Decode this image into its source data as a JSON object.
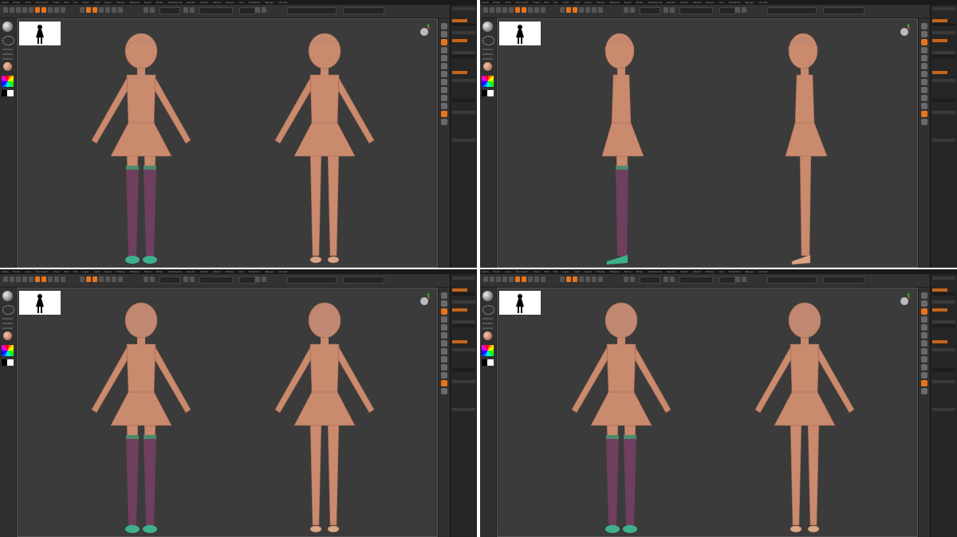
{
  "app": {
    "menu_items": [
      "Alpha",
      "Brush",
      "Color",
      "Document",
      "Draw",
      "Edit",
      "File",
      "Layer",
      "Light",
      "Macro",
      "Marker",
      "Material",
      "Movie",
      "Picker",
      "Preferences",
      "Render",
      "Stencil",
      "Stroke",
      "Texture",
      "Tool",
      "Transform",
      "Zplugin",
      "Zscript"
    ],
    "accent_color": "#e8741c",
    "background_color": "#3b3b3b"
  },
  "panels": [
    {
      "view": "front",
      "thumbnail_icon": "character-silhouette-icon",
      "figures": [
        {
          "variant": "stockings-shoes",
          "facing": "front"
        },
        {
          "variant": "bare-legs-pumps",
          "facing": "front"
        }
      ]
    },
    {
      "view": "side",
      "thumbnail_icon": "character-silhouette-icon",
      "figures": [
        {
          "variant": "stockings-shoes",
          "facing": "left"
        },
        {
          "variant": "bare-legs-pumps",
          "facing": "left"
        }
      ]
    },
    {
      "view": "back",
      "thumbnail_icon": "character-silhouette-icon",
      "figures": [
        {
          "variant": "stockings-shoes",
          "facing": "back"
        },
        {
          "variant": "bare-legs-pumps",
          "facing": "back"
        }
      ]
    },
    {
      "view": "back-three-quarter",
      "thumbnail_icon": "character-silhouette-icon",
      "figures": [
        {
          "variant": "stockings-shoes",
          "facing": "back-three-quarter"
        },
        {
          "variant": "bare-legs-pumps",
          "facing": "back-three-quarter"
        }
      ]
    }
  ],
  "colors": {
    "skin": "#c98a6e",
    "skin_dark": "#9e6650",
    "stockings": "#6e3f5e",
    "stocking_band": "#4e8a6a",
    "shoes": "#3fb08e",
    "hair": "#c08870",
    "pumps": "#d9a688"
  }
}
